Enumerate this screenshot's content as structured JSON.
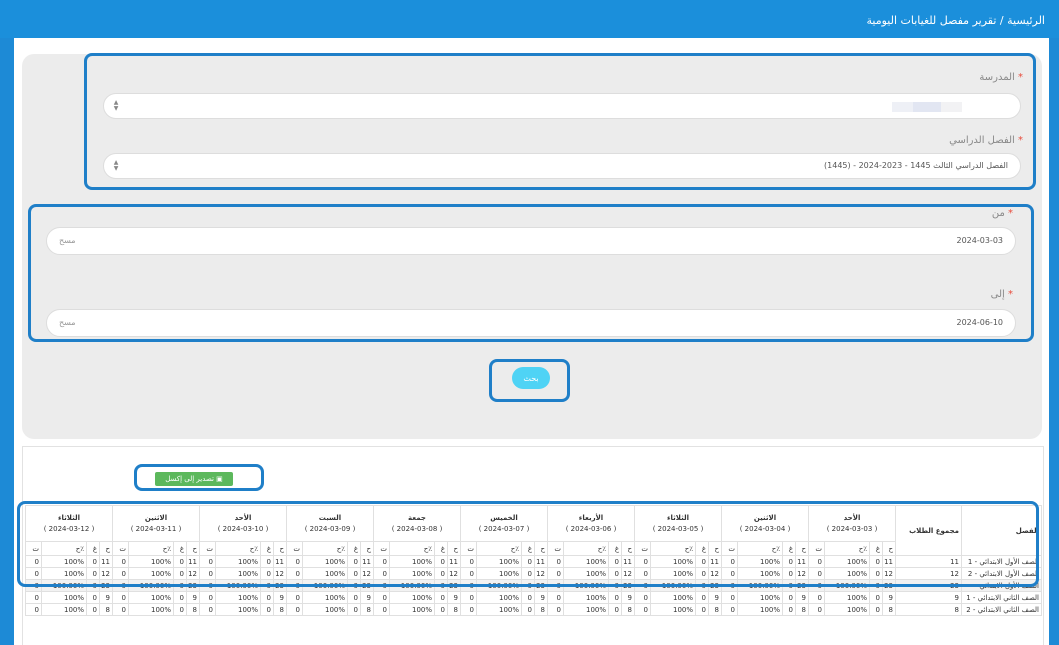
{
  "breadcrumb": "الرئيسية / تقرير مفصل للغيابات اليومية",
  "form": {
    "school_label": "المدرسة",
    "term_label": "الفصل الدراسي",
    "term_value": "الفصل الدراسي الثالث 1445 - 2023-2024 - (1445)",
    "from_label": "من",
    "from_value": "2024-03-03",
    "to_label": "إلى",
    "to_value": "2024-06-10",
    "clear_label": "مسح",
    "required_mark": "*",
    "search_label": "بحث"
  },
  "export_label": "تصدير إلى إكسل",
  "table": {
    "class_header": "الفصل",
    "students_header": "مجموع الطلاب",
    "sub_headers": [
      "ح",
      "غ",
      "٪ح",
      "ت"
    ],
    "days": [
      {
        "name": "الأحد",
        "date": "( 2024-03-03 )"
      },
      {
        "name": "الاثنين",
        "date": "( 2024-03-04 )"
      },
      {
        "name": "الثلاثاء",
        "date": "( 2024-03-05 )"
      },
      {
        "name": "الأربعاء",
        "date": "( 2024-03-06 )"
      },
      {
        "name": "الخميس",
        "date": "( 2024-03-07 )"
      },
      {
        "name": "جمعة",
        "date": "( 2024-03-08 )"
      },
      {
        "name": "السبت",
        "date": "( 2024-03-09 )"
      },
      {
        "name": "الأحد",
        "date": "( 2024-03-10 )"
      },
      {
        "name": "الاثنين",
        "date": "( 2024-03-11 )"
      },
      {
        "name": "الثلاثاء",
        "date": "( 2024-03-12 )"
      }
    ],
    "rows": [
      {
        "class": "الصف الأول الابتدائي - 1",
        "students": "11",
        "h": "11",
        "g": "0",
        "p": "100%",
        "t": "0",
        "total": false
      },
      {
        "class": "الصف الأول الابتدائي - 2",
        "students": "12",
        "h": "12",
        "g": "0",
        "p": "100%",
        "t": "0",
        "total": false
      },
      {
        "class": "الصف الأول الابتدائي",
        "students": "23",
        "h": "23",
        "g": "0",
        "p": "100.00%",
        "t": "0",
        "total": true
      },
      {
        "class": "الصف الثاني الابتدائي - 1",
        "students": "9",
        "h": "9",
        "g": "0",
        "p": "100%",
        "t": "0",
        "total": false
      },
      {
        "class": "الصف الثاني الابتدائي - 2",
        "students": "8",
        "h": "8",
        "g": "0",
        "p": "100%",
        "t": "0",
        "total": false
      }
    ]
  },
  "colors": {
    "header_bar": "#1b8fdb",
    "frame": "#1d8ad6",
    "accent": "#1f7fc8",
    "search": "#4fd3f5",
    "export": "#5cb85c"
  }
}
